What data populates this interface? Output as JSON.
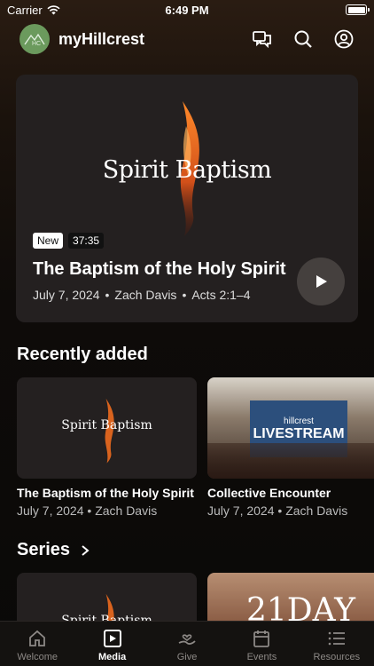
{
  "status": {
    "carrier": "Carrier",
    "time": "6:49 PM"
  },
  "header": {
    "app_title": "myHillcrest",
    "logo_text": "HC"
  },
  "hero": {
    "art_title": "Spirit Baptism",
    "badge_new": "New",
    "duration": "37:35",
    "title": "The Baptism of the Holy Spirit",
    "date": "July 7, 2024",
    "speaker": "Zach Davis",
    "scripture": "Acts 2:1–4",
    "separator": "•"
  },
  "recently_added": {
    "title": "Recently added",
    "items": [
      {
        "art_title": "Spirit Baptism",
        "title": "The Baptism of the Holy Spirit",
        "date": "July 7, 2024",
        "speaker": "Zach Davis"
      },
      {
        "art_title": "LIVESTREAM",
        "art_subtitle": "hillcrest",
        "title": "Collective Encounter",
        "date": "July 7, 2024",
        "speaker": "Zach Davis"
      }
    ]
  },
  "series": {
    "title": "Series",
    "items": [
      {
        "art_title": "Spirit Baptism"
      },
      {
        "art_title": "21DAY"
      }
    ]
  },
  "tabs": [
    {
      "label": "Welcome",
      "icon": "home-icon"
    },
    {
      "label": "Media",
      "icon": "media-icon"
    },
    {
      "label": "Give",
      "icon": "give-icon"
    },
    {
      "label": "Events",
      "icon": "calendar-icon"
    },
    {
      "label": "Resources",
      "icon": "list-icon"
    }
  ],
  "colors": {
    "accent_flame": "#e86a1c",
    "avatar_green": "#6b9a5d",
    "background": "#0e0b09"
  }
}
